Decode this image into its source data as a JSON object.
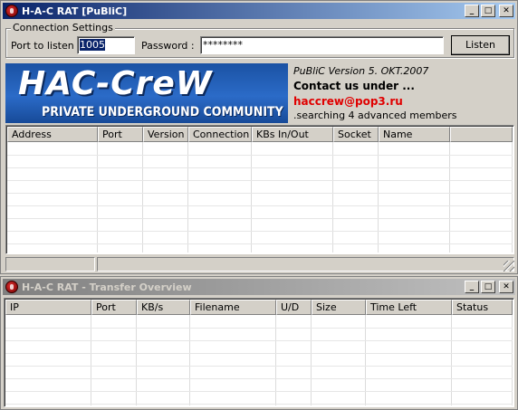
{
  "main_window": {
    "title": "H-A-C RAT [PuBliC]",
    "controls": [
      "_",
      "□",
      "✕"
    ]
  },
  "connection": {
    "group_label": "Connection Settings",
    "port_label": "Port to listen :",
    "port_value": "1005",
    "password_label": "Password :",
    "password_value": "********",
    "listen_label": "Listen"
  },
  "banner": {
    "logo_text": "HAC-CreW",
    "tagline": "PRIVATE UNDERGROUND COMMUNITY",
    "version": "PuBliC Version 5. OKT.2007",
    "contact": "Contact us under ...",
    "email": "haccrew@pop3.ru",
    "search": ".searching 4 advanced members"
  },
  "clients_list": {
    "columns": [
      "Address",
      "Port",
      "Version",
      "Connection",
      "KBs In/Out",
      "Socket",
      "Name",
      ""
    ]
  },
  "transfer_window": {
    "title": "H-A-C RAT - Transfer Overview",
    "controls": [
      "_",
      "□",
      "✕"
    ],
    "columns": [
      "IP",
      "Port",
      "KB/s",
      "Filename",
      "U/D",
      "Size",
      "Time Left",
      "Status"
    ]
  },
  "colors": {
    "active_title": "#0a246a",
    "inactive_title": "#808080",
    "email": "#e00000",
    "banner_blue": "#2b6bc8"
  }
}
